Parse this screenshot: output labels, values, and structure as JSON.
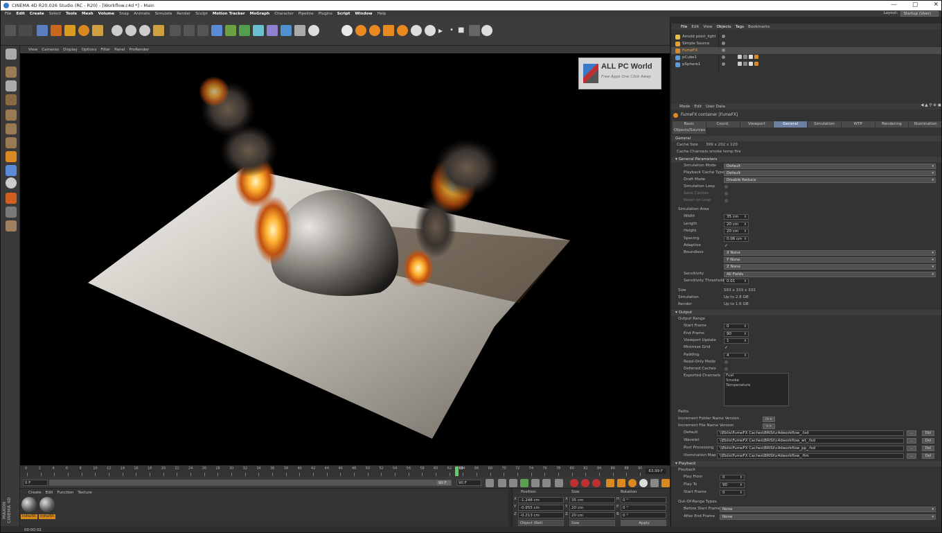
{
  "titlebar": {
    "title": "CINEMA 4D R20.026 Studio (RC - R20) - [Workflow.c4d *] - Main",
    "minimize": "—",
    "maximize": "▢"
  },
  "menubar": {
    "items": [
      "File",
      "Edit",
      "Create",
      "Select",
      "Tools",
      "Mesh",
      "Volume",
      "Snap",
      "Animate",
      "Simulate",
      "Render",
      "Sculpt",
      "Motion Tracker",
      "MoGraph",
      "Character",
      "Pipeline",
      "Plugins",
      "Script",
      "Window",
      "Help"
    ],
    "highlighted": [
      "Edit",
      "Create",
      "Tools",
      "Mesh",
      "Volume",
      "Motion Tracker",
      "MoGraph",
      "Script",
      "Window"
    ],
    "layout_label": "Layout:",
    "layout_value": "Startup (User)"
  },
  "viewport": {
    "menu": [
      "View",
      "Cameras",
      "Display",
      "Options",
      "Filter",
      "Panel",
      "ProRender"
    ],
    "watermark_title": "ALL PC World",
    "watermark_sub": "Free Apps One Click Away"
  },
  "timeline": {
    "ticks": [
      "0",
      "2",
      "4",
      "6",
      "8",
      "10",
      "12",
      "14",
      "16",
      "18",
      "20",
      "22",
      "24",
      "26",
      "28",
      "30",
      "32",
      "34",
      "36",
      "38",
      "40",
      "42",
      "44",
      "46",
      "48",
      "50",
      "52",
      "54",
      "56",
      "58",
      "60",
      "62",
      "64",
      "66",
      "68",
      "70",
      "72",
      "74",
      "76",
      "78",
      "80",
      "82",
      "84",
      "86",
      "88",
      "90"
    ],
    "current": "63",
    "end_readout": "63.99 F",
    "start_field": "0 F",
    "range_end": "90 F",
    "max_field": "90 F"
  },
  "materials": {
    "menu": [
      "Create",
      "Edit",
      "Function",
      "Texture"
    ],
    "items": [
      "initialSh",
      "initialSh"
    ],
    "maxon_label": "MAXON CINEMA 4D"
  },
  "coordinates": {
    "headers": [
      "Position",
      "Size",
      "Rotation"
    ],
    "rows": [
      {
        "axis": "X",
        "pos": "-1.248 cm",
        "size_axis": "X",
        "size": "35 cm",
        "rot_axis": "H",
        "rot": "0 °"
      },
      {
        "axis": "Y",
        "pos": "-0.955 cm",
        "size_axis": "Y",
        "size": "20 cm",
        "rot_axis": "P",
        "rot": "0 °"
      },
      {
        "axis": "Z",
        "pos": "-0.213 cm",
        "size_axis": "Z",
        "size": "20 cm",
        "rot_axis": "B",
        "rot": "0 °"
      }
    ],
    "mode": "Object (Rel)",
    "size_mode": "Size",
    "apply": "Apply"
  },
  "objects": {
    "menu": [
      "File",
      "Edit",
      "View",
      "Objects",
      "Tags",
      "Bookmarks"
    ],
    "items": [
      {
        "name": "Arnold point_light",
        "color": "#e8c040"
      },
      {
        "name": "Simple Source",
        "color": "#e8a030"
      },
      {
        "name": "FumeFX",
        "color": "#d88a2a"
      },
      {
        "name": "pCube1",
        "color": "#5a9ad8"
      },
      {
        "name": "pSphere1",
        "color": "#5a9ad8"
      }
    ]
  },
  "attributes": {
    "menu": [
      "Mode",
      "Edit",
      "User Data"
    ],
    "title": "FumeFX container [FumeFX]",
    "tabs": [
      "Basic",
      "Coord.",
      "Viewport",
      "General",
      "Simulation",
      "WTP",
      "Rendering",
      "Illumination"
    ],
    "active_tab": "General",
    "tab_row2": "Objects/Sources",
    "general_header": "General",
    "cache_size_label": "Cache Size",
    "cache_size_value": "399 x 202 x 120",
    "cache_channels": "Cache Channels:smoke temp fire",
    "gen_params": "▾ General Parameters",
    "sim_mode": {
      "label": "Simulation Mode",
      "value": "Default"
    },
    "playback_cache": {
      "label": "Playback Cache Type",
      "value": "Default"
    },
    "draft_mode": {
      "label": "Draft Mode",
      "value": "Disable Reduce"
    },
    "sim_loop": "Simulation Loop",
    "save_caches": "Save Caches",
    "reset_on_loop": "Reset on Loop",
    "sim_area": "Simulation Area",
    "width": {
      "label": "Width",
      "value": "35 cm"
    },
    "length": {
      "label": "Length",
      "value": "20 cm"
    },
    "height": {
      "label": "Height",
      "value": "20 cm"
    },
    "spacing": {
      "label": "Spacing",
      "value": "0.06 cm"
    },
    "adaptive": "Adaptive",
    "boundless": {
      "label": "Boundless",
      "x": "X None",
      "y": "Y None",
      "z": "Z None"
    },
    "sensitivity": {
      "label": "Sensitivity",
      "value": "All Fields"
    },
    "sens_threshold": {
      "label": "Sensitivity Threshold",
      "value": "0.01"
    },
    "size": {
      "label": "Size",
      "value": "583 x 333 x 333"
    },
    "simulation": {
      "label": "Simulation",
      "value": "Up to 2.8 GB"
    },
    "render": {
      "label": "Render",
      "value": "Up to 1.6 GB"
    },
    "output_hdr": "▾ Output",
    "output_range": "Output Range",
    "start_frame": {
      "label": "Start Frame",
      "value": "0"
    },
    "end_frame": {
      "label": "End Frame",
      "value": "90"
    },
    "viewport_update": {
      "label": "Viewport Update",
      "value": "1"
    },
    "minimize_grid": "Minimize Grid",
    "padding": {
      "label": "Padding",
      "value": "4"
    },
    "readonly_mode": "Read-Only Mode",
    "deferred_caches": "Deferred Caches",
    "exported_channels": {
      "label": "Exported Channels",
      "items": [
        "Fuel",
        "Smoke",
        "Temperature"
      ]
    },
    "paths": "Paths",
    "inc_folder": {
      "label": "Increment Folder Name Version",
      "btn": "/++"
    },
    "inc_file": {
      "label": "Increment File Name Version",
      "btn": "++"
    },
    "path_rows": [
      {
        "label": "Default",
        "value": "\\\\Eblis\\FumeFX Caches\\BRISt\\c4dworkflow_.fxd"
      },
      {
        "label": "Wavelet",
        "value": "\\\\Eblis\\FumeFX Caches\\BRISt\\c4dworkflow_wt_.fxd"
      },
      {
        "label": "Post Processing",
        "value": "\\\\Eblis\\FumeFX Caches\\BRISt\\c4dworkflow_pp_.fxd"
      },
      {
        "label": "Illumination Map",
        "value": "\\\\Eblis\\FumeFX Caches\\BRISt\\c4dworkflow_.fim"
      }
    ],
    "del": "Del",
    "dots": "...",
    "playback_hdr": "▾ Playback",
    "playback": "Playback",
    "play_from": {
      "label": "Play From",
      "value": "0"
    },
    "play_to": {
      "label": "Play To",
      "value": "90"
    },
    "pb_start": {
      "label": "Start Frame",
      "value": "0"
    },
    "oor_types": "Out-Of-Range Types",
    "before_start": {
      "label": "Before Start Frame",
      "value": "None"
    },
    "after_end": {
      "label": "After End Frame",
      "value": "None"
    }
  },
  "status": {
    "text": "00:00:02"
  }
}
